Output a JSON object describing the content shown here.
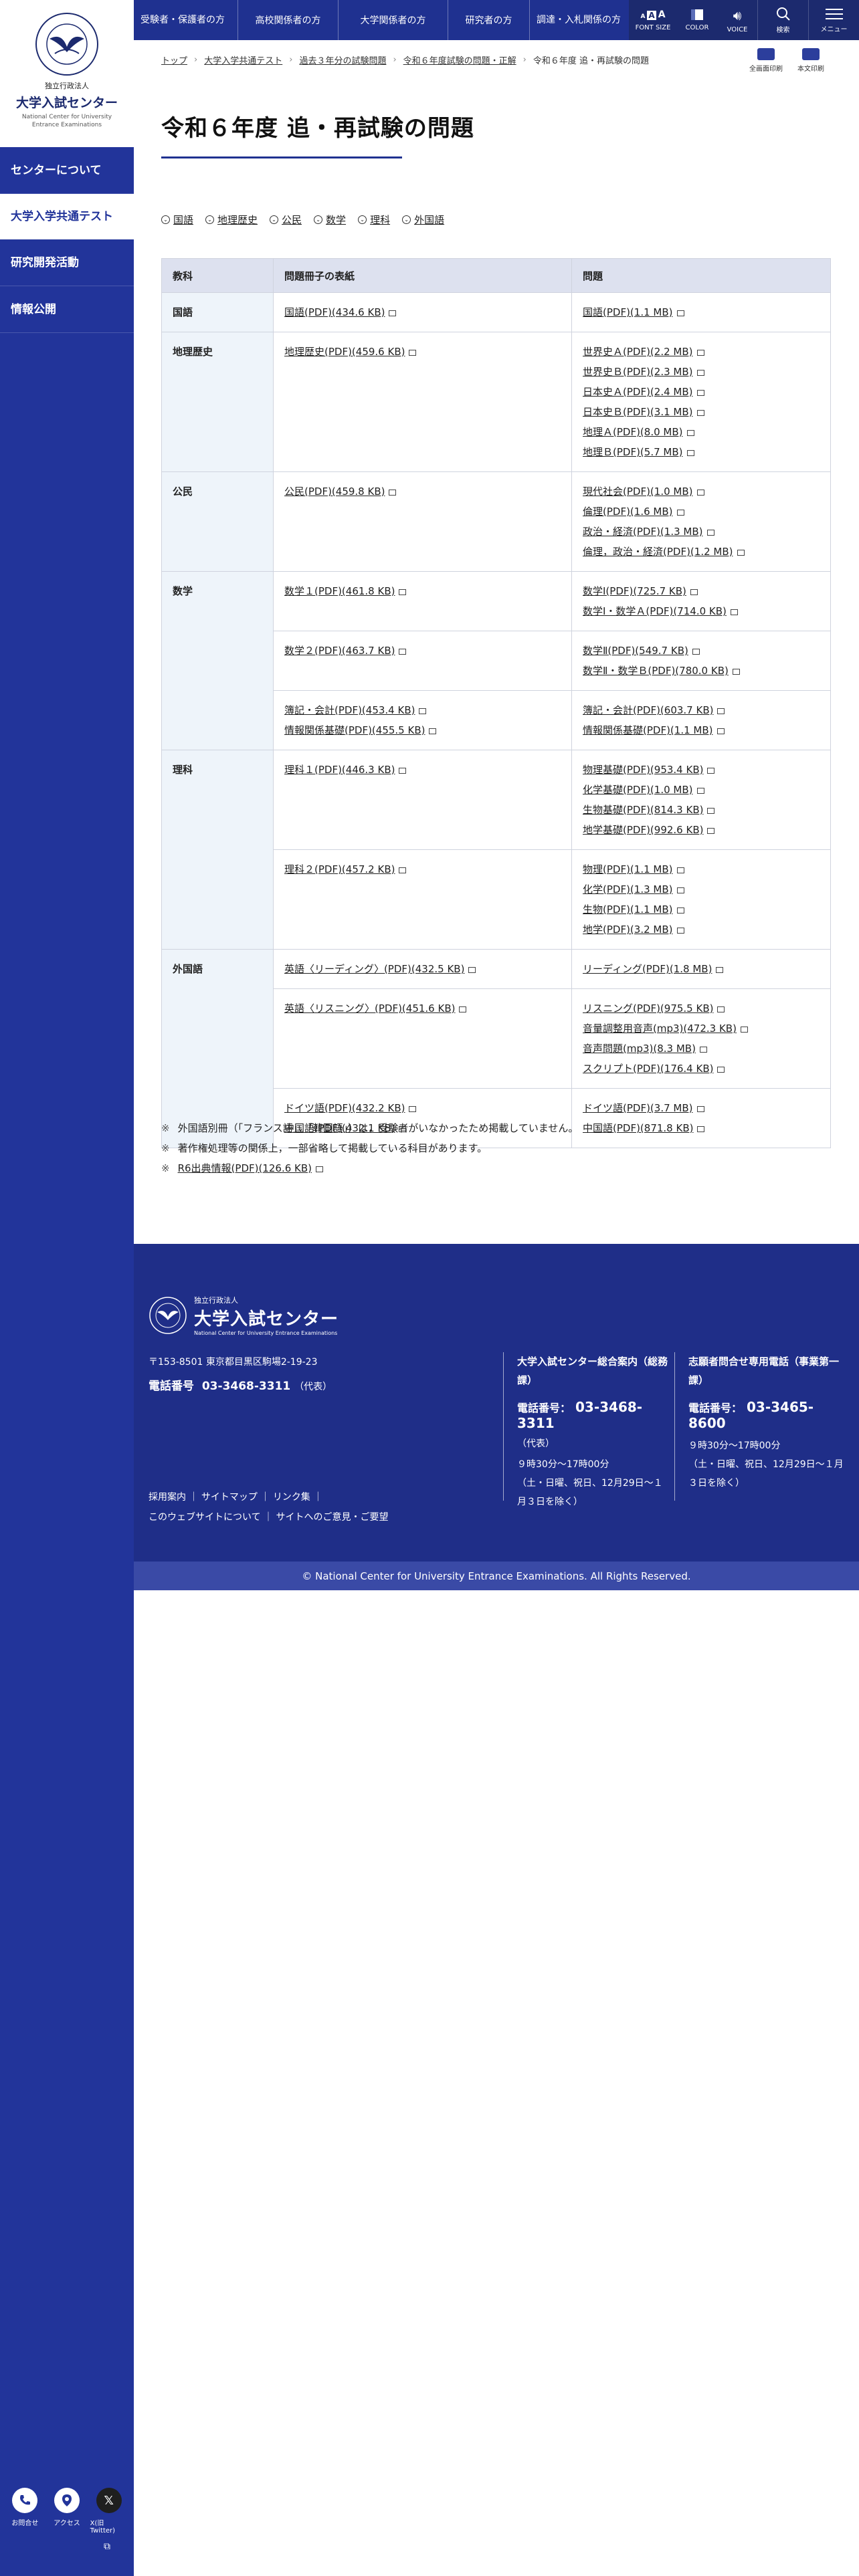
{
  "logo": {
    "emblem_text": "NATIONAL CENTER FOR UNIVERSITY ENTRANCE EXAMINATIONS",
    "pre": "独立行政法人",
    "name": "大学入試センター",
    "en": "National Center for University Entrance Examinations"
  },
  "sidebar": {
    "items": [
      {
        "label": "センターについて"
      },
      {
        "label": "大学入学共通テスト"
      },
      {
        "label": "研究開発活動"
      },
      {
        "label": "情報公開"
      }
    ],
    "bottom": [
      {
        "label": "お問合せ",
        "icon": "phone-icon"
      },
      {
        "label": "アクセス",
        "icon": "map-pin-icon"
      },
      {
        "label": "X(旧Twitter)",
        "icon": "x-logo-icon"
      }
    ],
    "ext_icon": "⧉"
  },
  "topnav": {
    "items": [
      {
        "label": "受験者・保護者の方"
      },
      {
        "label": "高校関係者の方"
      },
      {
        "label": "大学関係者の方"
      },
      {
        "label": "研究者の方"
      },
      {
        "label": "調達・入札関係の方"
      }
    ],
    "tools": {
      "font_size": "FONT SIZE",
      "color": "COLOR",
      "voice": "VOICE",
      "search": "検索",
      "menu": "メニュー"
    }
  },
  "breadcrumb": [
    {
      "label": "トップ"
    },
    {
      "label": "大学入学共通テスト"
    },
    {
      "label": "過去３年分の試験問題"
    },
    {
      "label": "令和６年度試験の問題・正解"
    },
    {
      "label": "令和６年度 追・再試験の問題"
    }
  ],
  "print": {
    "full": "全画面印刷",
    "body": "本文印刷"
  },
  "page": {
    "title": "令和６年度 追・再試験の問題"
  },
  "anchors": [
    "国語",
    "地理歴史",
    "公民",
    "数学",
    "理科",
    "外国語"
  ],
  "table": {
    "headers": [
      "教科",
      "問題冊子の表紙",
      "問題"
    ],
    "subjects": {
      "kokugo": "国語",
      "chireki": "地理歴史",
      "komin": "公民",
      "sugaku": "数学",
      "rika": "理科",
      "gaikokugo": "外国語"
    },
    "kokugo": {
      "cover": [
        "国語(PDF)(434.6 KB)"
      ],
      "problems": [
        "国語(PDF)(1.1 MB)"
      ]
    },
    "chireki": {
      "cover": [
        "地理歴史(PDF)(459.6 KB)"
      ],
      "problems": [
        "世界史Ａ(PDF)(2.2 MB)",
        "世界史Ｂ(PDF)(2.3 MB)",
        "日本史Ａ(PDF)(2.4 MB)",
        "日本史Ｂ(PDF)(3.1 MB)",
        "地理Ａ(PDF)(8.0 MB)",
        "地理Ｂ(PDF)(5.7 MB)"
      ]
    },
    "komin": {
      "cover": [
        "公民(PDF)(459.8 KB)"
      ],
      "problems": [
        "現代社会(PDF)(1.0 MB)",
        "倫理(PDF)(1.6 MB)",
        "政治・経済(PDF)(1.3 MB)",
        "倫理，政治・経済(PDF)(1.2 MB)"
      ]
    },
    "sugaku1": {
      "cover": [
        "数学１(PDF)(461.8 KB)"
      ],
      "problems": [
        "数学Ⅰ(PDF)(725.7 KB)",
        "数学Ⅰ・数学Ａ(PDF)(714.0 KB)"
      ]
    },
    "sugaku2": {
      "cover": [
        "数学２(PDF)(463.7 KB)"
      ],
      "problems": [
        "数学Ⅱ(PDF)(549.7 KB)",
        "数学Ⅱ・数学Ｂ(PDF)(780.0 KB)"
      ]
    },
    "sugaku3": {
      "cover": [
        "簿記・会計(PDF)(453.4 KB)",
        "情報関係基礎(PDF)(455.5 KB)"
      ],
      "problems": [
        "簿記・会計(PDF)(603.7 KB)",
        "情報関係基礎(PDF)(1.1 MB)"
      ]
    },
    "rika1": {
      "cover": [
        "理科１(PDF)(446.3 KB)"
      ],
      "problems": [
        "物理基礎(PDF)(953.4 KB)",
        "化学基礎(PDF)(1.0 MB)",
        "生物基礎(PDF)(814.3 KB)",
        "地学基礎(PDF)(992.6 KB)"
      ]
    },
    "rika2": {
      "cover": [
        "理科２(PDF)(457.2 KB)"
      ],
      "problems": [
        "物理(PDF)(1.1 MB)",
        "化学(PDF)(1.3 MB)",
        "生物(PDF)(1.1 MB)",
        "地学(PDF)(3.2 MB)"
      ]
    },
    "gai1": {
      "cover": [
        "英語〈リーディング〉(PDF)(432.5 KB)"
      ],
      "problems": [
        "リーディング(PDF)(1.8 MB)"
      ]
    },
    "gai2": {
      "cover": [
        "英語〈リスニング〉(PDF)(451.6 KB)"
      ],
      "problems": [
        "リスニング(PDF)(975.5 KB)",
        "音量調整用音声(mp3)(472.3 KB)",
        "音声問題(mp3)(8.3 MB)",
        "スクリプト(PDF)(176.4 KB)"
      ]
    },
    "gai3": {
      "cover": [
        "ドイツ語(PDF)(432.2 KB)",
        "中国語(PDF)(432.1 KB)"
      ],
      "problems": [
        "ドイツ語(PDF)(3.7 MB)",
        "中国語(PDF)(871.8 KB)"
      ]
    }
  },
  "notes": {
    "mark": "※",
    "n1": "外国語別冊（「フランス語」，「韓国語」）は，受験者がいなかったため掲載していません。",
    "n2": "著作権処理等の関係上，一部省略して掲載している科目があります。",
    "n3": "R6出典情報(PDF)(126.6 KB)"
  },
  "footer": {
    "pre": "独立行政法人",
    "name": "大学入試センター",
    "en": "National Center for University Entrance Examinations",
    "address": "〒153-8501 東京都目黒区駒場2-19-23",
    "tel_label": "電話番号",
    "tel": "03-3468-3311",
    "tel_rep": "（代表）",
    "links_row1": [
      "採用案内",
      "サイトマップ",
      "リンク集"
    ],
    "links_row2": [
      "このウェブサイトについて",
      "サイトへのご意見・ご要望"
    ],
    "col1": {
      "heading": "大学入試センター総合案内（総務課）",
      "tel_label": "電話番号：",
      "tel": "03-3468-3311",
      "rep": "（代表）",
      "hours": "９時30分～17時00分",
      "hours_note": "（土・日曜、祝日、12月29日～１月３日を除く）"
    },
    "col2": {
      "heading": "志願者問合せ専用電話（事業第一課）",
      "tel_label": "電話番号：",
      "tel": "03-3465-8600",
      "hours": "９時30分～17時00分",
      "hours_note": "（土・日曜、祝日、12月29日～１月３日を除く）"
    }
  },
  "copyright": "© National Center for University Entrance Examinations. All Rights Reserved.",
  "colors": {
    "primary": "#1f3190",
    "sidebar": "#22349a",
    "footer": "#1f2e88",
    "table_header": "#dde1ef",
    "subject_cell": "#eef4fa"
  }
}
